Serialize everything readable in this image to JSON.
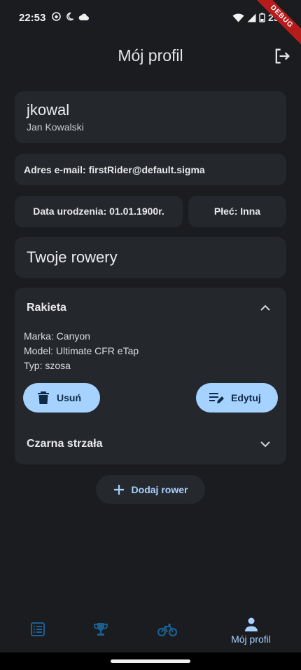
{
  "status": {
    "time": "22:53",
    "battery": "25%",
    "ribbon": "DEBUG"
  },
  "appbar": {
    "title": "Mój profil"
  },
  "profile": {
    "username": "jkowal",
    "full_name": "Jan Kowalski",
    "email_line": "Adres e-mail: firstRider@default.sigma",
    "birth_line": "Data urodzenia: 01.01.1900r.",
    "gender_line": "Płeć: Inna"
  },
  "bikes": {
    "section_title": "Twoje rowery",
    "items": [
      {
        "name": "Rakieta",
        "expanded": true,
        "brand_line": "Marka: Canyon",
        "model_line": "Model: Ultimate CFR eTap",
        "type_line": "Typ: szosa",
        "delete_label": "Usuń",
        "edit_label": "Edytuj"
      },
      {
        "name": "Czarna strzała",
        "expanded": false
      }
    ],
    "add_label": "Dodaj rower"
  },
  "nav": {
    "items": [
      {
        "icon": "list-icon",
        "label": ""
      },
      {
        "icon": "trophy-icon",
        "label": ""
      },
      {
        "icon": "bike-icon",
        "label": ""
      },
      {
        "icon": "person-icon",
        "label": "Mój profil",
        "active": true
      }
    ]
  },
  "colors": {
    "background": "#1a1c1f",
    "card": "#24272c",
    "accent": "#a6d2ff",
    "nav_icon": "#1d5f91"
  }
}
